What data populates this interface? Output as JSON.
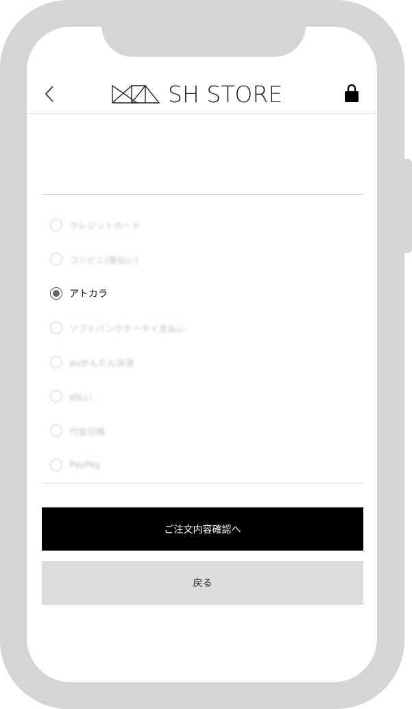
{
  "header": {
    "back_icon": "chevron-left-icon",
    "logo_text": "SH STORE",
    "cart_icon": "shopping-bag-icon"
  },
  "payment": {
    "options": [
      {
        "label": "クレジットカード",
        "selected": false
      },
      {
        "label": "コンビニ(後払い)",
        "selected": false
      },
      {
        "label": "アトカラ",
        "selected": true
      },
      {
        "label": "ソフトバンクケータイ支払い",
        "selected": false
      },
      {
        "label": "auかんたん決済",
        "selected": false
      },
      {
        "label": "d払い",
        "selected": false
      },
      {
        "label": "代金引換",
        "selected": false
      },
      {
        "label": "PayPay",
        "selected": false
      }
    ]
  },
  "actions": {
    "confirm_label": "ご注文内容確認へ",
    "back_label": "戻る"
  },
  "colors": {
    "primary_button": "#000000",
    "secondary_button": "#dcdcdc",
    "phone_frame": "#d5d5d5"
  }
}
